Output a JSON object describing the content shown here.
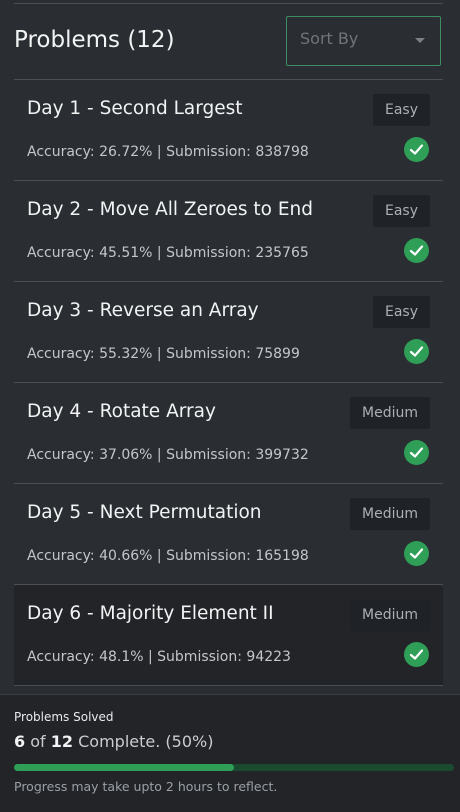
{
  "header": {
    "title": "Problems (12)",
    "sort_placeholder": "Sort By"
  },
  "problems": [
    {
      "title": "Day 1 - Second Largest",
      "stats": "Accuracy: 26.72% | Submission: 838798",
      "difficulty": "Easy",
      "solved": true
    },
    {
      "title": "Day 2 - Move All Zeroes to End",
      "stats": "Accuracy: 45.51% | Submission: 235765",
      "difficulty": "Easy",
      "solved": true
    },
    {
      "title": "Day 3 - Reverse an Array",
      "stats": "Accuracy: 55.32% | Submission: 75899",
      "difficulty": "Easy",
      "solved": true
    },
    {
      "title": "Day 4 - Rotate Array",
      "stats": "Accuracy: 37.06% | Submission: 399732",
      "difficulty": "Medium",
      "solved": true
    },
    {
      "title": "Day 5 - Next Permutation",
      "stats": "Accuracy: 40.66% | Submission: 165198",
      "difficulty": "Medium",
      "solved": true
    },
    {
      "title": "Day 6 - Majority Element II",
      "stats": "Accuracy: 48.1% | Submission: 94223",
      "difficulty": "Medium",
      "solved": true
    }
  ],
  "footer": {
    "label": "Problems Solved",
    "solved": "6",
    "of_text": "of",
    "total": "12",
    "complete_text": "Complete. (50%)",
    "progress_fraction": 0.5,
    "note": "Progress may take upto 2 hours to reflect."
  },
  "colors": {
    "accent": "#2f9e57",
    "background": "#2a2d31",
    "active_row": "#222427"
  }
}
